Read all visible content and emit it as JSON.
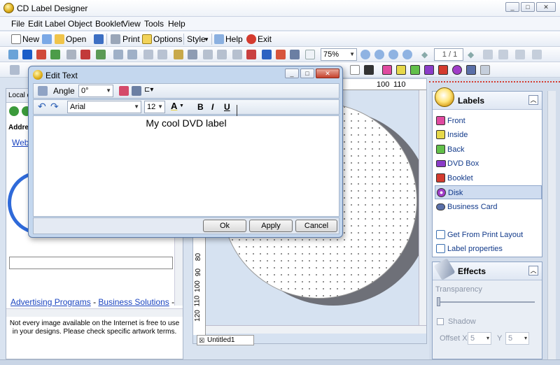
{
  "window": {
    "title": "CD Label Designer",
    "controls": [
      "_",
      "□",
      "✕"
    ]
  },
  "menu": [
    "File",
    "Edit",
    "Label",
    "Object",
    "Booklet",
    "View",
    "Tools",
    "Help"
  ],
  "toolbar1": {
    "new": "New",
    "open": "Open",
    "print": "Print",
    "options": "Options",
    "style": "Style",
    "help": "Help",
    "exit": "Exit"
  },
  "toolbar2": {
    "zoom": "75%",
    "page": "1 / 1"
  },
  "left": {
    "tab": "Local d",
    "address": "Addre",
    "web": "Web",
    "footer_link1": "Advertising Programs",
    "footer_sep": "-",
    "footer_link2": "Business Solutions",
    "footer_dash": "-",
    "notice": "Not every image available on the Internet is free to use in your designs. Please check specific artwork terms."
  },
  "ruler": {
    "top": [
      "100",
      "110"
    ],
    "left": [
      "80",
      "90",
      "100",
      "110",
      "120"
    ]
  },
  "doc_tab": "Untitled1",
  "dialog": {
    "title": "Edit Text",
    "angle_label": "Angle",
    "angle_value": "0°",
    "font": "Arial",
    "size": "12",
    "bold": "B",
    "italic": "I",
    "underline": "U",
    "text": "My cool DVD label",
    "ok": "Ok",
    "apply": "Apply",
    "cancel": "Cancel"
  },
  "labels": {
    "title": "Labels",
    "items": [
      "Front",
      "Inside",
      "Back",
      "DVD Box",
      "Booklet",
      "Disk",
      "Business Card"
    ],
    "selected": "Disk",
    "get_layout": "Get From Print Layout",
    "properties": "Label properties"
  },
  "effects": {
    "title": "Effects",
    "transparency": "Transparency",
    "shadow": "Shadow",
    "offset_x_label": "Offset X",
    "offset_x": "5",
    "y_label": "Y",
    "offset_y": "5"
  },
  "colors": {
    "accent": "#d43b2f",
    "select": "#cfdcf0"
  }
}
